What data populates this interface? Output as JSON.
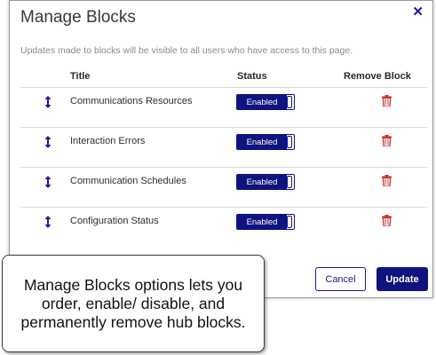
{
  "dialog": {
    "title": "Manage Blocks",
    "close_icon": "close-x-icon",
    "description": "Updates made to blocks will be visible to all users who have access to this page.",
    "columns": {
      "title": "Title",
      "status": "Status",
      "remove": "Remove Block"
    },
    "blocks": [
      {
        "title": "Communications Resources",
        "status": "Enabled"
      },
      {
        "title": "Interaction Errors",
        "status": "Enabled"
      },
      {
        "title": "Communication Schedules",
        "status": "Enabled"
      },
      {
        "title": "Configuration Status",
        "status": "Enabled"
      }
    ],
    "buttons": {
      "cancel": "Cancel",
      "update": "Update"
    }
  },
  "callout": {
    "text": "Manage Blocks options lets you order, enable/ disable, and permanently remove hub blocks."
  },
  "colors": {
    "accent": "#10127d",
    "trash": "#d0312d",
    "drag_handle": "#1a1a9c"
  }
}
